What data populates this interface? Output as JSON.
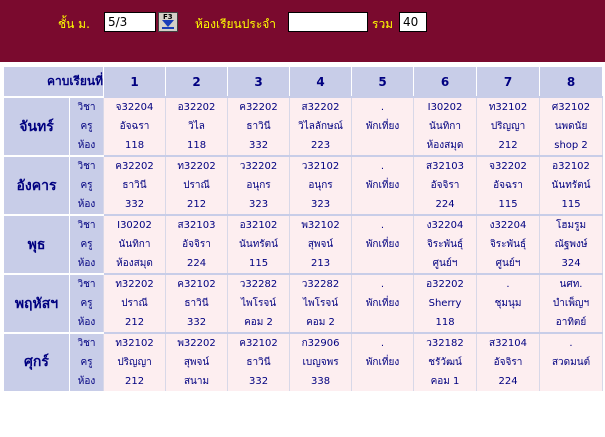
{
  "header": {
    "class_label": "ชั้น ม.",
    "class_value": "5/3",
    "dropdown_key": "F3",
    "room_label": "ห้องเรียนประจำ",
    "room_value": "",
    "total_label": "รวม",
    "total_value": "40"
  },
  "colors": {
    "header_bg": "#7a0a2e",
    "label_text": "#ffff00",
    "table_header_bg": "#c8cde8",
    "cell_bg": "#fdeef0",
    "text": "#000080"
  },
  "table": {
    "corner_label": "คาบเรียนที่",
    "periods": [
      "1",
      "2",
      "3",
      "4",
      "5",
      "6",
      "7",
      "8"
    ],
    "row_labels": [
      "วิชา",
      "ครู",
      "ห้อง"
    ],
    "days": [
      {
        "name": "จันทร์",
        "cells": [
          [
            "จ32204",
            "อัจฉรา",
            "118"
          ],
          [
            "อ32202",
            "วิไล",
            "118"
          ],
          [
            "ค32202",
            "ธาวินี",
            "332"
          ],
          [
            "ส32202",
            "วิไลลักษณ์",
            "223"
          ],
          [
            ".",
            "พักเที่ยง",
            ""
          ],
          [
            "I30202",
            "นันทิกา",
            "ห้องสมุด"
          ],
          [
            "ท32102",
            "ปริญญา",
            "212"
          ],
          [
            "ศ32102",
            "นพดนัย",
            "shop 2"
          ]
        ]
      },
      {
        "name": "อังคาร",
        "cells": [
          [
            "ค32202",
            "ธาวินี",
            "332"
          ],
          [
            "ท32202",
            "ปราณี",
            "212"
          ],
          [
            "ว32202",
            "อนุกร",
            "323"
          ],
          [
            "ว32102",
            "อนุกร",
            "323"
          ],
          [
            ".",
            "พักเที่ยง",
            ""
          ],
          [
            "ส32103",
            "อัจจิรา",
            "224"
          ],
          [
            "จ32202",
            "อัจฉรา",
            "115"
          ],
          [
            "อ32102",
            "นันทรัตน์",
            "115"
          ]
        ]
      },
      {
        "name": "พุธ",
        "cells": [
          [
            "I30202",
            "นันทิกา",
            "ห้องสมุด"
          ],
          [
            "ส32103",
            "อัจจิรา",
            "224"
          ],
          [
            "อ32102",
            "นันทรัตน์",
            "115"
          ],
          [
            "พ32102",
            "สุพจน์",
            "213"
          ],
          [
            ".",
            "พักเที่ยง",
            ""
          ],
          [
            "ง32204",
            "จิระพันธุ์",
            "ศูนย์ฯ"
          ],
          [
            "ง32204",
            "จิระพันธุ์",
            "ศูนย์ฯ"
          ],
          [
            "โฮมรูม",
            "ณัฐพงษ์",
            "324"
          ]
        ]
      },
      {
        "name": "พฤหัสฯ",
        "cells": [
          [
            "ท32202",
            "ปราณี",
            "212"
          ],
          [
            "ค32102",
            "ธาวินี",
            "332"
          ],
          [
            "ว32282",
            "ไพโรจน์",
            "คอม 2"
          ],
          [
            "ว32282",
            "ไพโรจน์",
            "คอม 2"
          ],
          [
            ".",
            "พักเที่ยง",
            ""
          ],
          [
            "อ32202",
            "Sherry",
            "118"
          ],
          [
            ".",
            "ชุมนุม",
            ""
          ],
          [
            "นศท.",
            "บำเพ็ญฯ",
            "อาทิตย์"
          ]
        ]
      },
      {
        "name": "ศุกร์",
        "cells": [
          [
            "ท32102",
            "ปริญญา",
            "212"
          ],
          [
            "พ32202",
            "สุพจน์",
            "สนาม"
          ],
          [
            "ค32102",
            "ธาวินี",
            "332"
          ],
          [
            "ก32906",
            "เบญจพร",
            "338"
          ],
          [
            ".",
            "พักเที่ยง",
            ""
          ],
          [
            "ว32182",
            "ชรัวัฒน์",
            "คอม 1"
          ],
          [
            "ส32104",
            "อัจจิรา",
            "224"
          ],
          [
            ".",
            "สวดมนต์",
            ""
          ]
        ]
      }
    ]
  }
}
